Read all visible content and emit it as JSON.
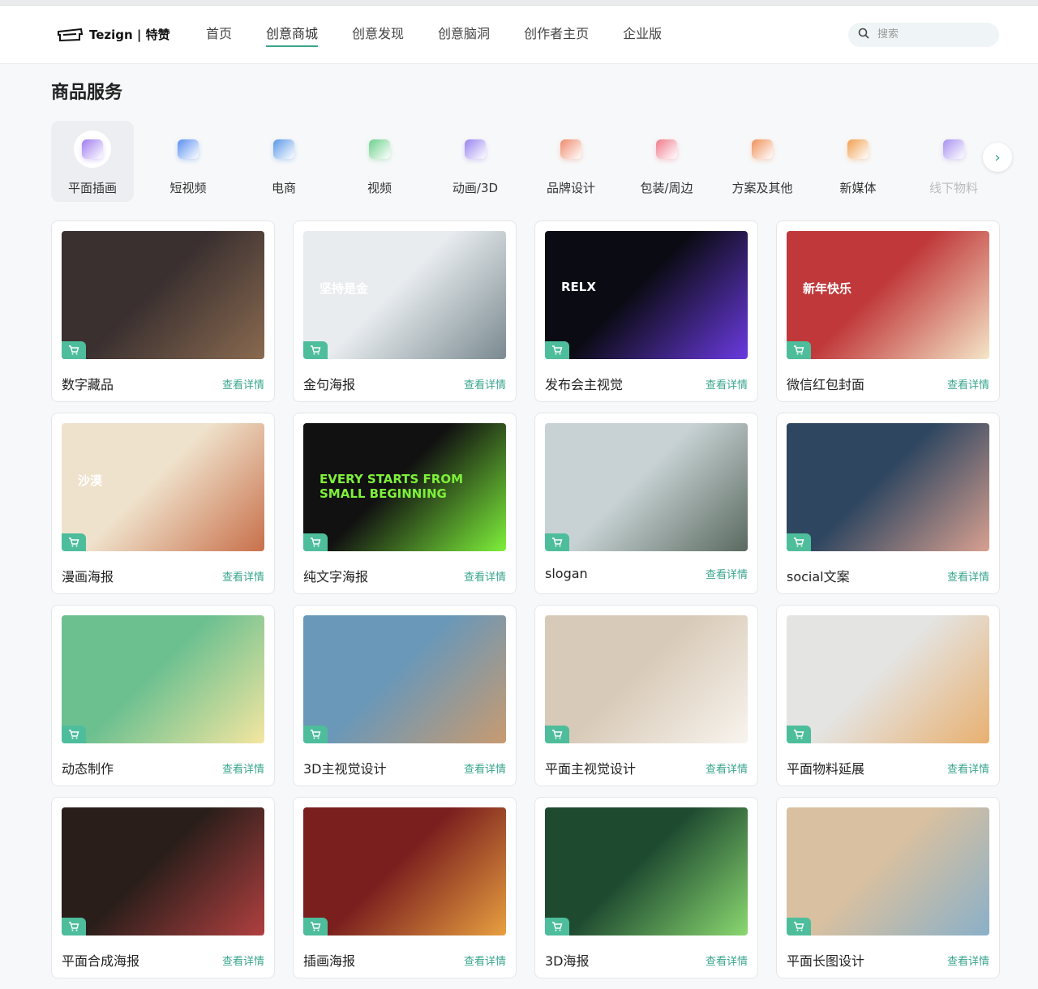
{
  "brand": {
    "name": "Tezign | 特赞"
  },
  "nav": {
    "items": [
      {
        "label": "首页"
      },
      {
        "label": "创意商城"
      },
      {
        "label": "创意发现"
      },
      {
        "label": "创意脑洞"
      },
      {
        "label": "创作者主页"
      },
      {
        "label": "企业版"
      }
    ],
    "active_index": 1
  },
  "search": {
    "placeholder": "搜索"
  },
  "page": {
    "title": "商品服务"
  },
  "categories": [
    {
      "label": "平面插画",
      "icon": "illustration-icon",
      "color": "#a07cf0"
    },
    {
      "label": "短视频",
      "icon": "short-video-icon",
      "color": "#5a8ff0"
    },
    {
      "label": "电商",
      "icon": "ecommerce-icon",
      "color": "#5a98e8"
    },
    {
      "label": "视频",
      "icon": "video-icon",
      "color": "#6cd08c"
    },
    {
      "label": "动画/3D",
      "icon": "animation-icon",
      "color": "#9a82f0"
    },
    {
      "label": "品牌设计",
      "icon": "brand-icon",
      "color": "#f08a6c"
    },
    {
      "label": "包装/周边",
      "icon": "package-icon",
      "color": "#f07a8c"
    },
    {
      "label": "方案及其他",
      "icon": "solution-icon",
      "color": "#f0905a"
    },
    {
      "label": "新媒体",
      "icon": "new-media-icon",
      "color": "#f0a050"
    },
    {
      "label": "线下物料",
      "icon": "offline-material-icon",
      "color": "#a890f0"
    }
  ],
  "cards": [
    {
      "title": "数字藏品",
      "link": "查看详情",
      "thumb": "#3a3030",
      "thumb2": "#8a6a50",
      "text": ""
    },
    {
      "title": "金句海报",
      "link": "查看详情",
      "thumb": "#e8ecef",
      "thumb2": "#7a8a90",
      "text": "坚持是金"
    },
    {
      "title": "发布会主视觉",
      "link": "查看详情",
      "thumb": "#0b0b14",
      "thumb2": "#6a3ae0",
      "text": "RELX"
    },
    {
      "title": "微信红包封面",
      "link": "查看详情",
      "thumb": "#c0383a",
      "thumb2": "#f4e6c8",
      "text": "新年快乐"
    },
    {
      "title": "漫画海报",
      "link": "查看详情",
      "thumb": "#efe2cc",
      "thumb2": "#c8704a",
      "text": "沙漠"
    },
    {
      "title": "纯文字海报",
      "link": "查看详情",
      "thumb": "#111111",
      "thumb2": "#7ef03a",
      "text": "EVERY STARTS FROM SMALL BEGINNING"
    },
    {
      "title": "slogan",
      "link": "查看详情",
      "thumb": "#c8d2d4",
      "thumb2": "#5a6a60",
      "text": ""
    },
    {
      "title": "social文案",
      "link": "查看详情",
      "thumb": "#2e4660",
      "thumb2": "#d8a090",
      "text": ""
    },
    {
      "title": "动态制作",
      "link": "查看详情",
      "thumb": "#6cc090",
      "thumb2": "#f4e6a0",
      "text": ""
    },
    {
      "title": "3D主视觉设计",
      "link": "查看详情",
      "thumb": "#6a98b8",
      "thumb2": "#c89a70",
      "text": ""
    },
    {
      "title": "平面主视觉设计",
      "link": "查看详情",
      "thumb": "#d8cab8",
      "thumb2": "#f8f4ee",
      "text": ""
    },
    {
      "title": "平面物料延展",
      "link": "查看详情",
      "thumb": "#e4e4e2",
      "thumb2": "#e8b070",
      "text": ""
    },
    {
      "title": "平面合成海报",
      "link": "查看详情",
      "thumb": "#2a1e1a",
      "thumb2": "#b04040",
      "text": ""
    },
    {
      "title": "插画海报",
      "link": "查看详情",
      "thumb": "#7a1e1e",
      "thumb2": "#e8a040",
      "text": ""
    },
    {
      "title": "3D海报",
      "link": "查看详情",
      "thumb": "#1e4a30",
      "thumb2": "#8ad870",
      "text": ""
    },
    {
      "title": "平面长图设计",
      "link": "查看详情",
      "thumb": "#d8c0a0",
      "thumb2": "#8ab0c8",
      "text": ""
    }
  ]
}
